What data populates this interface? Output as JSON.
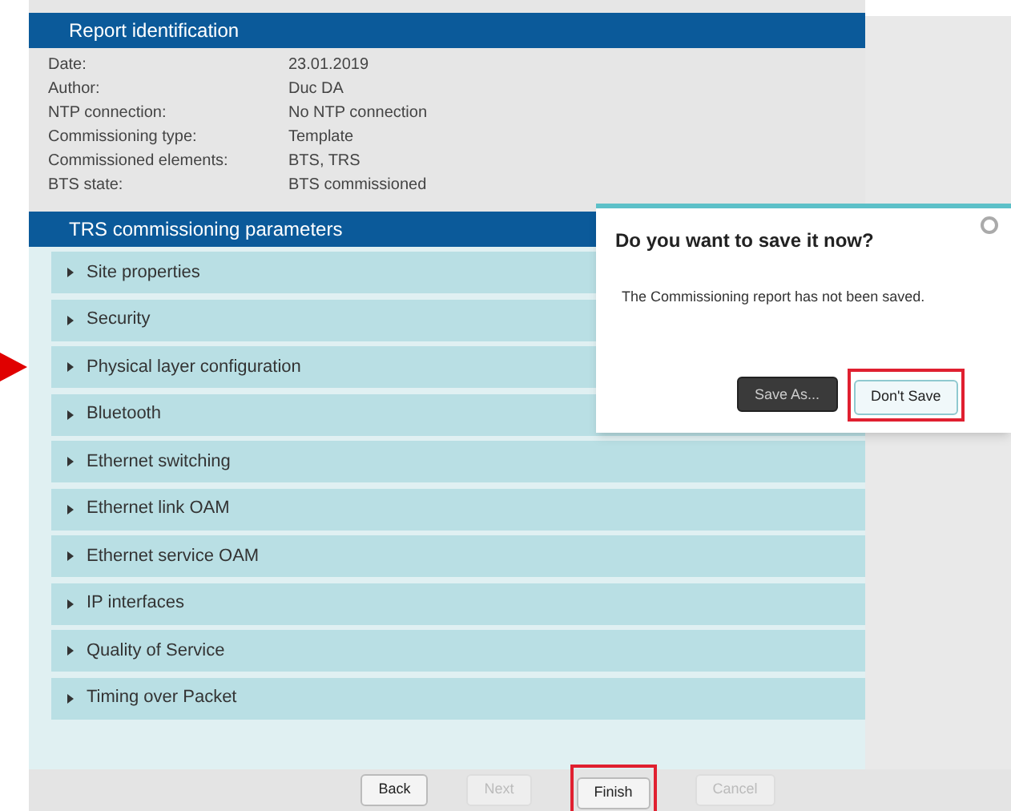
{
  "report_identification": {
    "title": "Report identification",
    "fields": [
      {
        "label": "Date:",
        "value": "23.01.2019"
      },
      {
        "label": "Author:",
        "value": "Duc DA"
      },
      {
        "label": "NTP connection:",
        "value": "No NTP connection"
      },
      {
        "label": "Commissioning type:",
        "value": "Template"
      },
      {
        "label": "Commissioned elements:",
        "value": "BTS, TRS"
      },
      {
        "label": "BTS state:",
        "value": "BTS commissioned"
      }
    ]
  },
  "trs_parameters": {
    "title": "TRS commissioning parameters",
    "sections": [
      {
        "label": "Site properties",
        "pointed": false
      },
      {
        "label": "Security",
        "pointed": false
      },
      {
        "label": "Physical layer configuration",
        "pointed": true
      },
      {
        "label": "Bluetooth",
        "pointed": false
      },
      {
        "label": "Ethernet switching",
        "pointed": false
      },
      {
        "label": "Ethernet link OAM",
        "pointed": false
      },
      {
        "label": "Ethernet service OAM",
        "pointed": false
      },
      {
        "label": "IP interfaces",
        "pointed": false
      },
      {
        "label": "Quality of Service",
        "pointed": false
      },
      {
        "label": "Timing over Packet",
        "pointed": false
      }
    ]
  },
  "footer_buttons": [
    {
      "label": "Back",
      "disabled": false,
      "highlighted": false
    },
    {
      "label": "Next",
      "disabled": true,
      "highlighted": false
    },
    {
      "label": "Finish",
      "disabled": false,
      "highlighted": true
    },
    {
      "label": "Cancel",
      "disabled": true,
      "highlighted": false
    }
  ],
  "dialog": {
    "title": "Do you want to save it now?",
    "message": "The Commissioning report has not been saved.",
    "buttons": [
      {
        "label": "Save As...",
        "kind": "dark",
        "highlighted": false
      },
      {
        "label": "Don't Save",
        "kind": "light",
        "highlighted": true
      }
    ]
  }
}
